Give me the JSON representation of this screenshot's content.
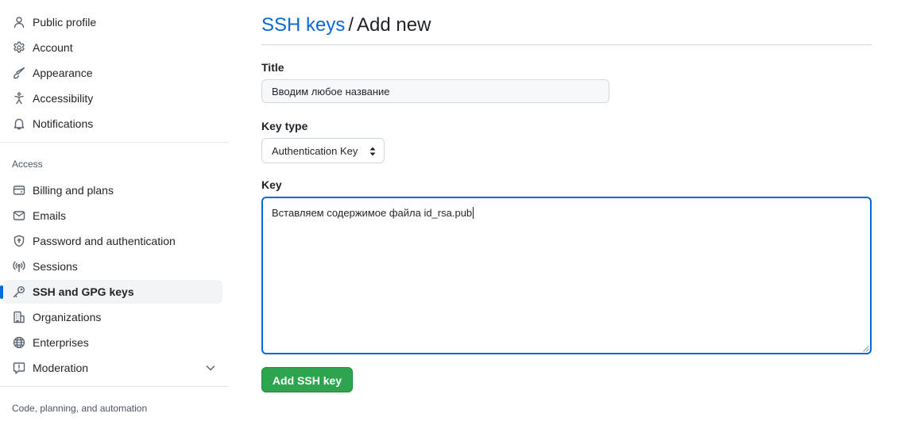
{
  "sidebar": {
    "items_top": [
      {
        "label": "Public profile",
        "icon": "person-icon"
      },
      {
        "label": "Account",
        "icon": "gear-icon"
      },
      {
        "label": "Appearance",
        "icon": "paintbrush-icon"
      },
      {
        "label": "Accessibility",
        "icon": "accessibility-icon"
      },
      {
        "label": "Notifications",
        "icon": "bell-icon"
      }
    ],
    "access_header": "Access",
    "items_access": [
      {
        "label": "Billing and plans",
        "icon": "credit-card-icon"
      },
      {
        "label": "Emails",
        "icon": "mail-icon"
      },
      {
        "label": "Password and authentication",
        "icon": "shield-lock-icon"
      },
      {
        "label": "Sessions",
        "icon": "broadcast-icon"
      },
      {
        "label": "SSH and GPG keys",
        "icon": "key-icon",
        "selected": true
      },
      {
        "label": "Organizations",
        "icon": "organization-icon"
      },
      {
        "label": "Enterprises",
        "icon": "globe-icon"
      },
      {
        "label": "Moderation",
        "icon": "report-icon",
        "expandable": true
      }
    ],
    "code_header": "Code, planning, and automation"
  },
  "main": {
    "breadcrumb_link": "SSH keys",
    "breadcrumb_separator": "/",
    "breadcrumb_current": "Add new",
    "title_label": "Title",
    "title_value": "Вводим любое название",
    "key_type_label": "Key type",
    "key_type_value": "Authentication Key",
    "key_label": "Key",
    "key_value": "Вставляем содержимое файла id_rsa.pub",
    "submit_label": "Add SSH key"
  },
  "colors": {
    "accent": "#0969da",
    "primary_button": "#2da44e",
    "selected_bg": "#f3f4f6",
    "text": "#1f2328"
  }
}
